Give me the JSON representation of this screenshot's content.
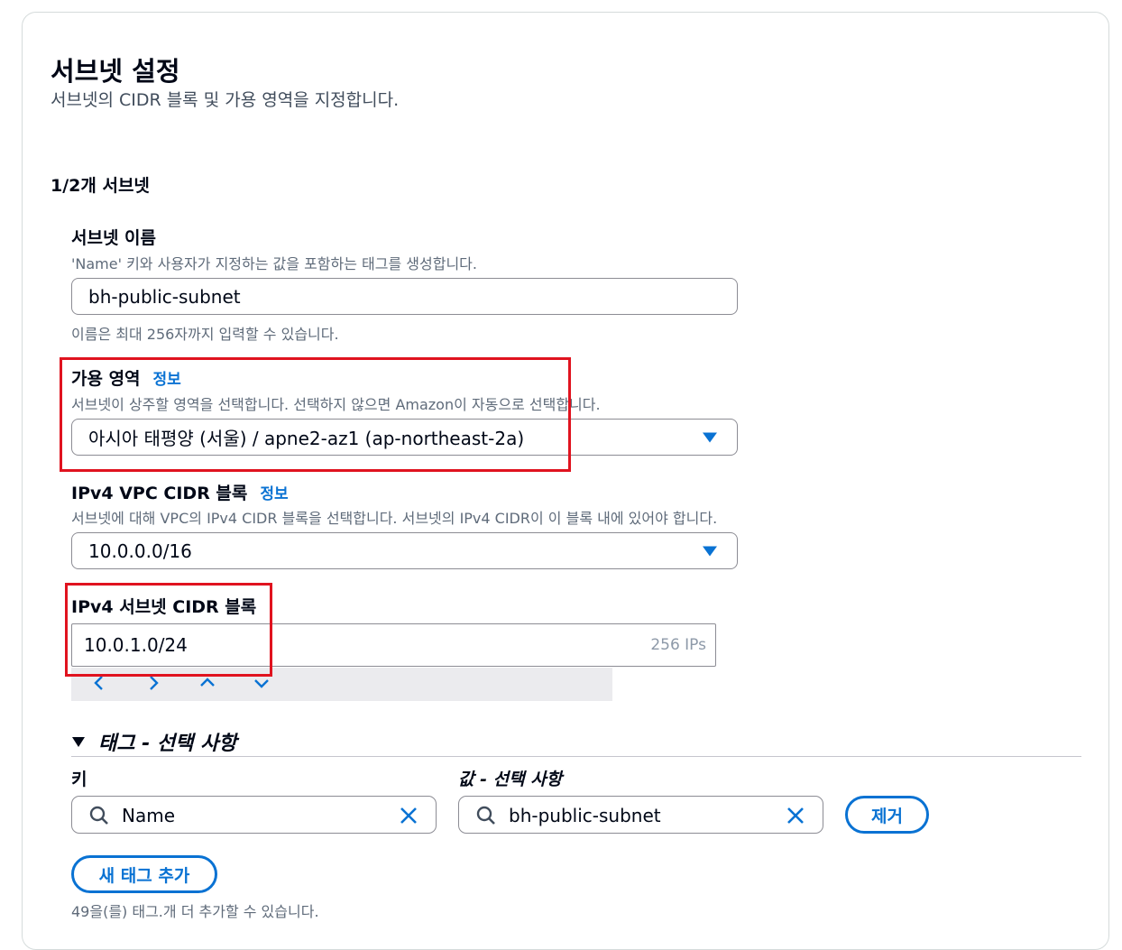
{
  "header": {
    "title": "서브넷 설정",
    "subtitle": "서브넷의 CIDR 블록 및 가용 영역을 지정합니다."
  },
  "subnet_count": "1/2개 서브넷",
  "subnet_name": {
    "label": "서브넷 이름",
    "description": "'Name' 키와 사용자가 지정하는 값을 포함하는 태그를 생성합니다.",
    "value": "bh-public-subnet",
    "constraint": "이름은 최대 256자까지 입력할 수 있습니다."
  },
  "availability_zone": {
    "label": "가용 영역",
    "info": "정보",
    "description": "서브넷이 상주할 영역을 선택합니다. 선택하지 않으면 Amazon이 자동으로 선택합니다.",
    "value": "아시아 태평양 (서울) / apne2-az1 (ap-northeast-2a)"
  },
  "vpc_cidr": {
    "label": "IPv4 VPC CIDR 블록",
    "info": "정보",
    "description": "서브넷에 대해 VPC의 IPv4 CIDR 블록을 선택합니다. 서브넷의 IPv4 CIDR이 이 블록 내에 있어야 합니다.",
    "value": "10.0.0.0/16"
  },
  "subnet_cidr": {
    "label": "IPv4 서브넷 CIDR 블록",
    "value": "10.0.1.0/24",
    "ip_count": "256 IPs"
  },
  "tags": {
    "header": "태그 - 선택 사항",
    "key_label": "키",
    "value_label": "값 - 선택 사항",
    "key_value": "Name",
    "value_value": "bh-public-subnet",
    "remove_label": "제거",
    "add_label": "새 태그 추가",
    "limit_text": "49을(를) 태그.개 더 추가할 수 있습니다."
  },
  "colors": {
    "accent": "#0972d3",
    "highlight": "#e0131f"
  }
}
